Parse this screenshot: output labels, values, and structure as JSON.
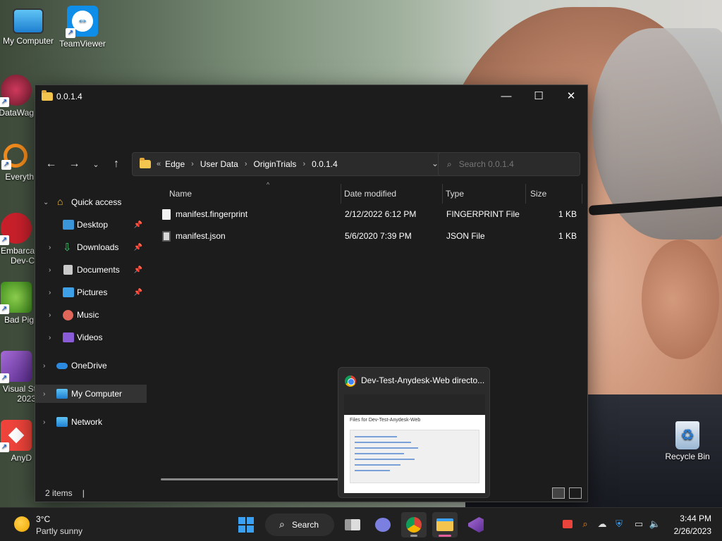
{
  "desktop": {
    "icons": [
      {
        "label": "My Computer"
      },
      {
        "label": "TeamViewer"
      },
      {
        "label": "DataWag"
      },
      {
        "label": "Everyth"
      },
      {
        "label": "Embarca Dev-C"
      },
      {
        "label": "Bad Pig"
      },
      {
        "label": "Visual St 2023"
      },
      {
        "label": "AnyD"
      },
      {
        "label": "Recycle Bin"
      }
    ]
  },
  "window": {
    "title": "0.0.1.4",
    "controls": {
      "minimize": "—",
      "maximize": "☐",
      "close": "✕"
    },
    "breadcrumb": {
      "overflow": "«",
      "items": [
        "Edge",
        "User Data",
        "OriginTrials",
        "0.0.1.4"
      ]
    },
    "search": {
      "placeholder": "Search 0.0.1.4"
    },
    "nav": [
      {
        "label": "Quick access"
      },
      {
        "label": "Desktop"
      },
      {
        "label": "Downloads"
      },
      {
        "label": "Documents"
      },
      {
        "label": "Pictures"
      },
      {
        "label": "Music"
      },
      {
        "label": "Videos"
      },
      {
        "label": "OneDrive"
      },
      {
        "label": "My Computer"
      },
      {
        "label": "Network"
      }
    ],
    "columns": {
      "name": "Name",
      "date": "Date modified",
      "type": "Type",
      "size": "Size"
    },
    "files": [
      {
        "name": "manifest.fingerprint",
        "date": "2/12/2022 6:12 PM",
        "type": "FINGERPRINT File",
        "size": "1 KB"
      },
      {
        "name": "manifest.json",
        "date": "5/6/2020 7:39 PM",
        "type": "JSON File",
        "size": "1 KB"
      }
    ],
    "status": {
      "items": "2 items",
      "sep": "|"
    }
  },
  "preview": {
    "title": "Dev-Test-Anydesk-Web directo...",
    "page_heading": "Files for Dev-Test-Anydesk-Web"
  },
  "taskbar": {
    "weather": {
      "temp": "3°C",
      "desc": "Partly sunny"
    },
    "search_label": "Search",
    "clock": {
      "time": "3:44 PM",
      "date": "2/26/2023"
    }
  },
  "colors": {
    "accent": "#3aa0f3",
    "folder": "#f4c54e",
    "window_bg": "#1c1c1c",
    "taskbar_bg": "#202020"
  }
}
